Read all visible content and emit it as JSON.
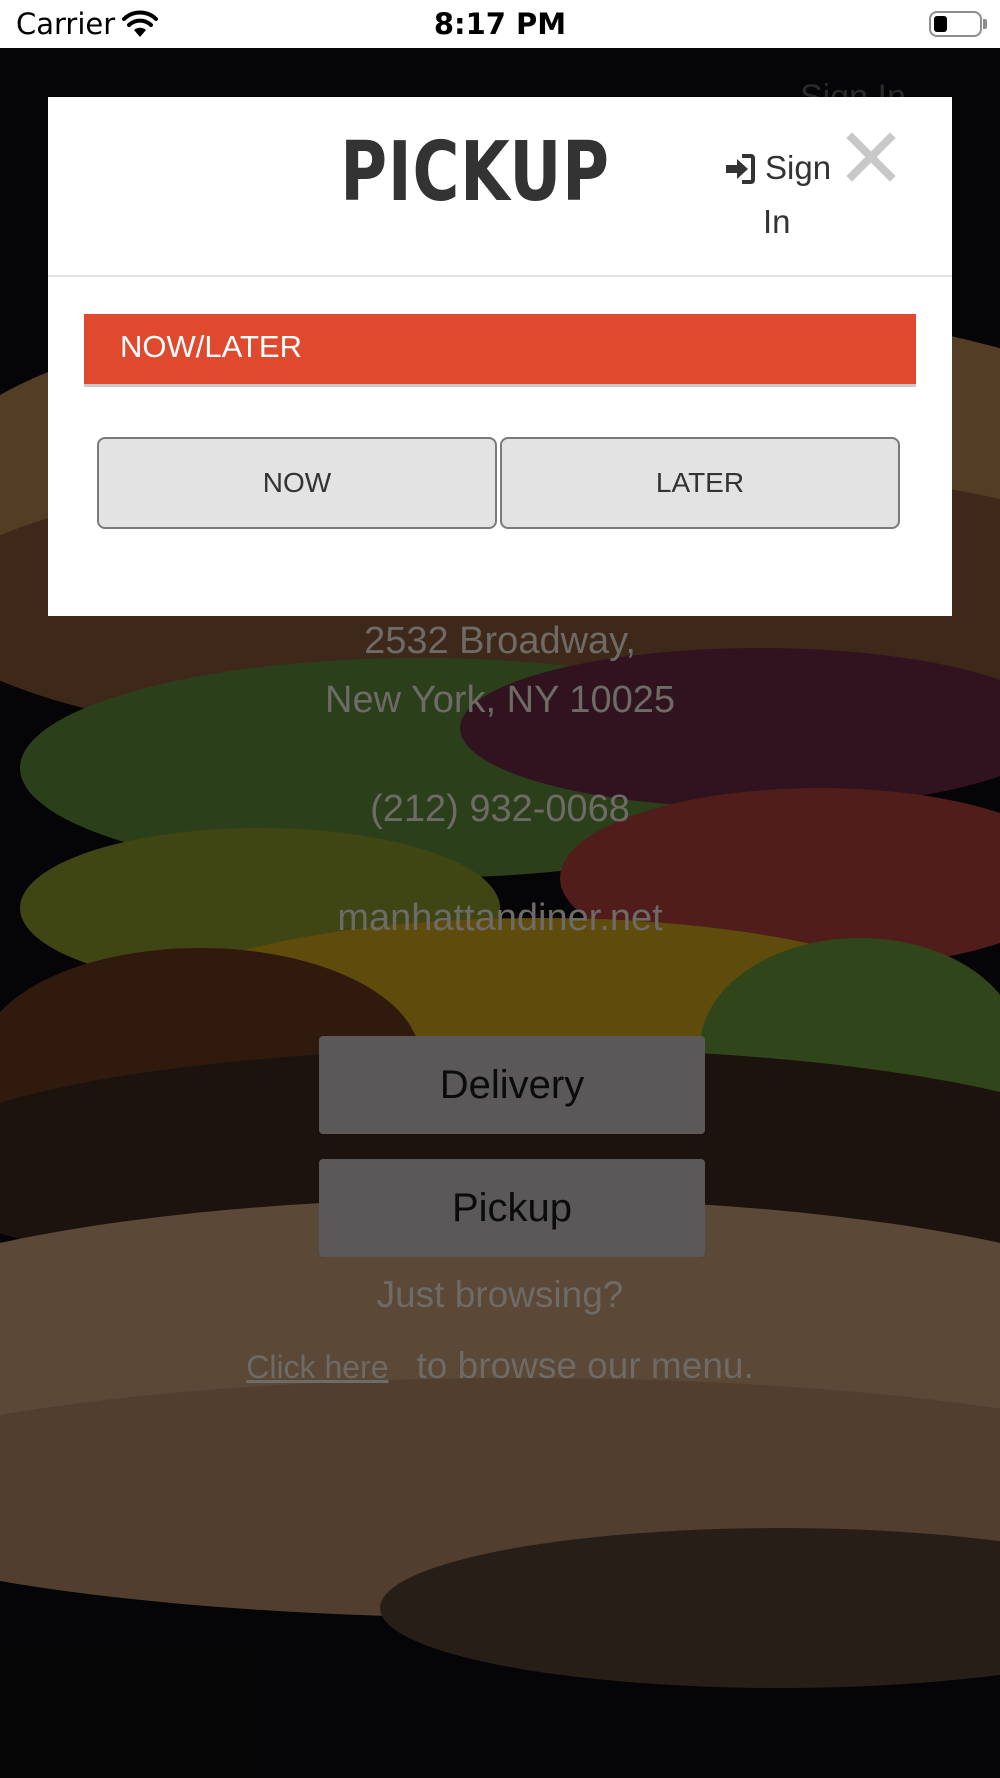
{
  "status_bar": {
    "carrier": "Carrier",
    "time": "8:17 PM"
  },
  "modal": {
    "title": "PICKUP",
    "sign_in_word1": "Sign",
    "sign_in_word2": "In",
    "section_label": "NOW/LATER",
    "options": [
      "NOW",
      "LATER"
    ]
  },
  "background": {
    "sign_in": "Sign In",
    "address_line1": "2532 Broadway,",
    "address_line2": "New York, NY 10025",
    "phone": "(212) 932-0068",
    "website": "manhattandiner.net",
    "delivery_button": "Delivery",
    "pickup_button": "Pickup",
    "browsing_prompt": "Just browsing?",
    "click_here": "Click here",
    "browse_suffix": "to browse our menu."
  },
  "colors": {
    "accent": "#df4a2f",
    "modal_bg": "#ffffff",
    "title": "#333333"
  }
}
